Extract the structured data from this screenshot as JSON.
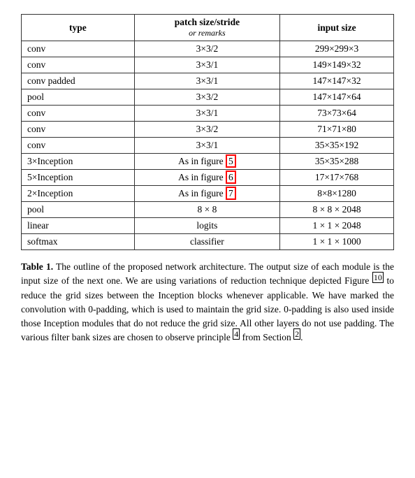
{
  "table": {
    "headers": [
      {
        "label": "type",
        "sub": ""
      },
      {
        "label": "patch size/stride",
        "sub": "or remarks"
      },
      {
        "label": "input size",
        "sub": ""
      }
    ],
    "rows": [
      {
        "type": "conv",
        "patch": "3×3/2",
        "input": "299×299×3"
      },
      {
        "type": "conv",
        "patch": "3×3/1",
        "input": "149×149×32"
      },
      {
        "type": "conv padded",
        "patch": "3×3/1",
        "input": "147×147×32"
      },
      {
        "type": "pool",
        "patch": "3×3/2",
        "input": "147×147×64"
      },
      {
        "type": "conv",
        "patch": "3×3/1",
        "input": "73×73×64"
      },
      {
        "type": "conv",
        "patch": "3×3/2",
        "input": "71×71×80"
      },
      {
        "type": "conv",
        "patch": "3×3/1",
        "input": "35×35×192"
      },
      {
        "type": "3×Inception",
        "patch": "As in figure 5",
        "input": "35×35×288",
        "highlight_patch": true
      },
      {
        "type": "5×Inception",
        "patch": "As in figure 6",
        "input": "17×17×768",
        "highlight_patch": true
      },
      {
        "type": "2×Inception",
        "patch": "As in figure 7",
        "input": "8×8×1280",
        "highlight_patch": true
      },
      {
        "type": "pool",
        "patch": "8 × 8",
        "input": "8 × 8 × 2048"
      },
      {
        "type": "linear",
        "patch": "logits",
        "input": "1 × 1 × 2048"
      },
      {
        "type": "softmax",
        "patch": "classifier",
        "input": "1 × 1 × 1000"
      }
    ]
  },
  "caption": {
    "title": "Table 1.",
    "text": " The outline of the proposed network architecture.  The output size of each module is the input size of the next one.  We are using variations of reduction technique depicted Figure ",
    "ref1": "10",
    "text2": " to reduce the grid sizes between the Inception blocks whenever applicable. We have marked the convolution with 0-padding, which is used to maintain the grid size.  0-padding is also used inside those Inception modules that do not reduce the grid size. All other layers do not use padding. The various filter bank sizes are chosen to observe principle ",
    "ref2": "4",
    "text3": " from Section ",
    "ref3": "2",
    "text4": "."
  },
  "highlights": {
    "fig5": "5",
    "fig6": "6",
    "fig7": "7"
  }
}
